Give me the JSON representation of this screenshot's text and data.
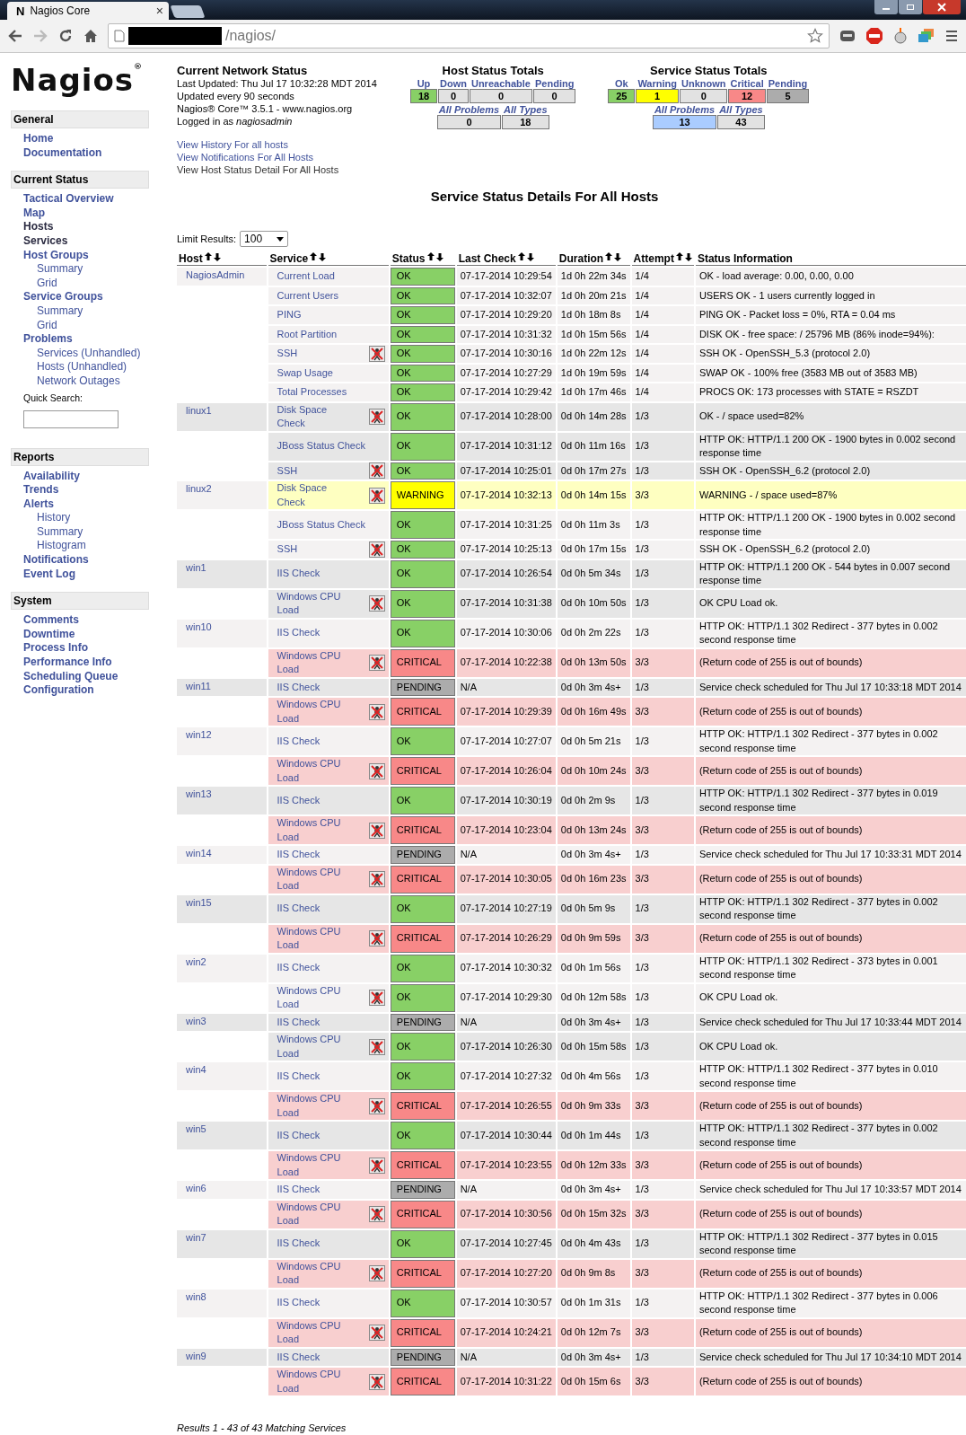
{
  "browser": {
    "favicon": "N",
    "tab_title": "Nagios Core",
    "tab_close": "×",
    "url": "/nagios/"
  },
  "logo": "Nagios$^{®}$",
  "sidebar": [
    {
      "title": "General",
      "items": [
        {
          "label": "Home",
          "visited": false
        },
        {
          "label": "Documentation",
          "visited": false
        }
      ]
    },
    {
      "title": "Current Status",
      "items": [
        {
          "label": "Tactical Overview",
          "visited": false
        },
        {
          "label": "Map",
          "visited": false
        },
        {
          "label": "Hosts",
          "visited": true
        },
        {
          "label": "Services",
          "visited": true
        },
        {
          "label": "Host Groups",
          "visited": false,
          "children": [
            {
              "label": "Summary",
              "visited": false
            },
            {
              "label": "Grid",
              "visited": false
            }
          ]
        },
        {
          "label": "Service Groups",
          "visited": false,
          "children": [
            {
              "label": "Summary",
              "visited": false
            },
            {
              "label": "Grid",
              "visited": false
            }
          ]
        },
        {
          "label": "Problems",
          "visited": false,
          "children": [
            {
              "label": "Services (Unhandled)",
              "visited": false
            },
            {
              "label": "Hosts (Unhandled)",
              "visited": false
            },
            {
              "label": "Network Outages",
              "visited": false
            }
          ]
        }
      ],
      "quick_search": {
        "label": "Quick Search:"
      }
    },
    {
      "title": "Reports",
      "items": [
        {
          "label": "Availability",
          "visited": false
        },
        {
          "label": "Trends",
          "visited": false
        },
        {
          "label": "Alerts",
          "visited": false,
          "children": [
            {
              "label": "History",
              "visited": false
            },
            {
              "label": "Summary",
              "visited": false
            },
            {
              "label": "Histogram",
              "visited": false
            }
          ]
        },
        {
          "label": "Notifications",
          "visited": false
        },
        {
          "label": "Event Log",
          "visited": false
        }
      ]
    },
    {
      "title": "System",
      "items": [
        {
          "label": "Comments",
          "visited": false
        },
        {
          "label": "Downtime",
          "visited": false
        },
        {
          "label": "Process Info",
          "visited": false
        },
        {
          "label": "Performance Info",
          "visited": false
        },
        {
          "label": "Scheduling Queue",
          "visited": false
        },
        {
          "label": "Configuration",
          "visited": false
        }
      ]
    }
  ],
  "network_status": {
    "title": "Current Network Status",
    "lines": [
      "Last Updated: Thu Jul 17 10:32:28 MDT 2014",
      "Updated every 90 seconds",
      "Nagios® Core™ 3.5.1 - www.nagios.org",
      "Logged in as *nagiosadmin*"
    ],
    "links": [
      "View History For all hosts",
      "View Notifications For All Hosts",
      "View Host Status Detail For All Hosts"
    ]
  },
  "host_totals": {
    "title": "Host Status Totals",
    "columns": [
      {
        "label": "Up",
        "value": "18",
        "kind": "ok"
      },
      {
        "label": "Down",
        "value": "0",
        "kind": "neutral"
      },
      {
        "label": "Unreachable",
        "value": "0",
        "kind": "neutral"
      },
      {
        "label": "Pending",
        "value": "0",
        "kind": "neutral"
      }
    ],
    "summary": [
      {
        "label": "All Problems",
        "value": "0",
        "kind": "neutral"
      },
      {
        "label": "All Types",
        "value": "18",
        "kind": "neutral"
      }
    ]
  },
  "service_totals": {
    "title": "Service Status Totals",
    "columns": [
      {
        "label": "Ok",
        "value": "25",
        "kind": "ok"
      },
      {
        "label": "Warning",
        "value": "1",
        "kind": "warning"
      },
      {
        "label": "Unknown",
        "value": "0",
        "kind": "neutral"
      },
      {
        "label": "Critical",
        "value": "12",
        "kind": "critical"
      },
      {
        "label": "Pending",
        "value": "5",
        "kind": "pending"
      }
    ],
    "summary": [
      {
        "label": "All Problems",
        "value": "13",
        "kind": "highlight"
      },
      {
        "label": "All Types",
        "value": "43",
        "kind": "neutral"
      }
    ]
  },
  "page_title": "Service Status Details For All Hosts",
  "limit": {
    "label": "Limit Results:",
    "value": "100"
  },
  "table": {
    "columns": [
      {
        "label": "Host",
        "sortable": true
      },
      {
        "label": "Service",
        "sortable": true
      },
      {
        "label": "Status",
        "sortable": true
      },
      {
        "label": "Last Check",
        "sortable": true
      },
      {
        "label": "Duration",
        "sortable": true
      },
      {
        "label": "Attempt",
        "sortable": true
      },
      {
        "label": "Status Information",
        "sortable": false
      }
    ],
    "hosts": [
      {
        "name": "NagiosAdmin",
        "services": [
          {
            "name": "Current Load",
            "icon": false,
            "kind": "ok",
            "status": "OK",
            "last_check": "07-17-2014 10:29:54",
            "duration": "1d 0h 22m 34s",
            "attempt": "1/4",
            "info": "OK - load average: 0.00, 0.00, 0.00"
          },
          {
            "name": "Current Users",
            "icon": false,
            "kind": "ok",
            "status": "OK",
            "last_check": "07-17-2014 10:32:07",
            "duration": "1d 0h 20m 21s",
            "attempt": "1/4",
            "info": "USERS OK - 1 users currently logged in"
          },
          {
            "name": "PING",
            "icon": false,
            "kind": "ok",
            "status": "OK",
            "last_check": "07-17-2014 10:29:20",
            "duration": "1d 0h 18m 8s",
            "attempt": "1/4",
            "info": "PING OK - Packet loss = 0%, RTA = 0.04 ms"
          },
          {
            "name": "Root Partition",
            "icon": false,
            "kind": "ok",
            "status": "OK",
            "last_check": "07-17-2014 10:31:32",
            "duration": "1d 0h 15m 56s",
            "attempt": "1/4",
            "info": "DISK OK - free space: / 25796 MB (86% inode=94%):"
          },
          {
            "name": "SSH",
            "icon": true,
            "kind": "ok",
            "status": "OK",
            "last_check": "07-17-2014 10:30:16",
            "duration": "1d 0h 22m 12s",
            "attempt": "1/4",
            "info": "SSH OK - OpenSSH_5.3 (protocol 2.0)"
          },
          {
            "name": "Swap Usage",
            "icon": false,
            "kind": "ok",
            "status": "OK",
            "last_check": "07-17-2014 10:27:29",
            "duration": "1d 0h 19m 59s",
            "attempt": "1/4",
            "info": "SWAP OK - 100% free (3583 MB out of 3583 MB)"
          },
          {
            "name": "Total Processes",
            "icon": false,
            "kind": "ok",
            "status": "OK",
            "last_check": "07-17-2014 10:29:42",
            "duration": "1d 0h 17m 46s",
            "attempt": "1/4",
            "info": "PROCS OK: 173 processes with STATE = RSZDT"
          }
        ]
      },
      {
        "name": "linux1",
        "services": [
          {
            "name": "Disk Space Check",
            "icon": true,
            "kind": "ok",
            "status": "OK",
            "last_check": "07-17-2014 10:28:00",
            "duration": "0d 0h 14m 28s",
            "attempt": "1/3",
            "info": "OK - / space used=82%"
          },
          {
            "name": "JBoss Status Check",
            "icon": false,
            "kind": "ok",
            "status": "OK",
            "last_check": "07-17-2014 10:31:12",
            "duration": "0d 0h 11m 16s",
            "attempt": "1/3",
            "info": "HTTP OK: HTTP/1.1 200 OK - 1900 bytes in 0.002 second response time"
          },
          {
            "name": "SSH",
            "icon": true,
            "kind": "ok",
            "status": "OK",
            "last_check": "07-17-2014 10:25:01",
            "duration": "0d 0h 17m 27s",
            "attempt": "1/3",
            "info": "SSH OK - OpenSSH_6.2 (protocol 2.0)"
          }
        ]
      },
      {
        "name": "linux2",
        "services": [
          {
            "name": "Disk Space Check",
            "icon": true,
            "kind": "warning",
            "status": "WARNING",
            "last_check": "07-17-2014 10:32:13",
            "duration": "0d 0h 14m 15s",
            "attempt": "3/3",
            "info": "WARNING - / space used=87%"
          },
          {
            "name": "JBoss Status Check",
            "icon": false,
            "kind": "ok",
            "status": "OK",
            "last_check": "07-17-2014 10:31:25",
            "duration": "0d 0h 11m 3s",
            "attempt": "1/3",
            "info": "HTTP OK: HTTP/1.1 200 OK - 1900 bytes in 0.002 second response time"
          },
          {
            "name": "SSH",
            "icon": true,
            "kind": "ok",
            "status": "OK",
            "last_check": "07-17-2014 10:25:13",
            "duration": "0d 0h 17m 15s",
            "attempt": "1/3",
            "info": "SSH OK - OpenSSH_6.2 (protocol 2.0)"
          }
        ]
      },
      {
        "name": "win1",
        "services": [
          {
            "name": "IIS Check",
            "icon": false,
            "kind": "ok",
            "status": "OK",
            "last_check": "07-17-2014 10:26:54",
            "duration": "0d 0h 5m 34s",
            "attempt": "1/3",
            "info": "HTTP OK: HTTP/1.1 200 OK - 544 bytes in 0.007 second response time"
          },
          {
            "name": "Windows CPU Load",
            "icon": true,
            "kind": "ok",
            "status": "OK",
            "last_check": "07-17-2014 10:31:38",
            "duration": "0d 0h 10m 50s",
            "attempt": "1/3",
            "info": "OK CPU Load ok."
          }
        ]
      },
      {
        "name": "win10",
        "services": [
          {
            "name": "IIS Check",
            "icon": false,
            "kind": "ok",
            "status": "OK",
            "last_check": "07-17-2014 10:30:06",
            "duration": "0d 0h 2m 22s",
            "attempt": "1/3",
            "info": "HTTP OK: HTTP/1.1 302 Redirect - 377 bytes in 0.002 second response time"
          },
          {
            "name": "Windows CPU Load",
            "icon": true,
            "kind": "critical",
            "status": "CRITICAL",
            "last_check": "07-17-2014 10:22:38",
            "duration": "0d 0h 13m 50s",
            "attempt": "3/3",
            "info": "(Return code of 255 is out of bounds)"
          }
        ]
      },
      {
        "name": "win11",
        "services": [
          {
            "name": "IIS Check",
            "icon": false,
            "kind": "pending",
            "status": "PENDING",
            "last_check": "N/A",
            "duration": "0d 0h 3m 4s+",
            "attempt": "1/3",
            "info": "Service check scheduled for Thu Jul 17 10:33:18 MDT 2014"
          },
          {
            "name": "Windows CPU Load",
            "icon": true,
            "kind": "critical",
            "status": "CRITICAL",
            "last_check": "07-17-2014 10:29:39",
            "duration": "0d 0h 16m 49s",
            "attempt": "3/3",
            "info": "(Return code of 255 is out of bounds)"
          }
        ]
      },
      {
        "name": "win12",
        "services": [
          {
            "name": "IIS Check",
            "icon": false,
            "kind": "ok",
            "status": "OK",
            "last_check": "07-17-2014 10:27:07",
            "duration": "0d 0h 5m 21s",
            "attempt": "1/3",
            "info": "HTTP OK: HTTP/1.1 302 Redirect - 377 bytes in 0.002 second response time"
          },
          {
            "name": "Windows CPU Load",
            "icon": true,
            "kind": "critical",
            "status": "CRITICAL",
            "last_check": "07-17-2014 10:26:04",
            "duration": "0d 0h 10m 24s",
            "attempt": "3/3",
            "info": "(Return code of 255 is out of bounds)"
          }
        ]
      },
      {
        "name": "win13",
        "services": [
          {
            "name": "IIS Check",
            "icon": false,
            "kind": "ok",
            "status": "OK",
            "last_check": "07-17-2014 10:30:19",
            "duration": "0d 0h 2m 9s",
            "attempt": "1/3",
            "info": "HTTP OK: HTTP/1.1 302 Redirect - 377 bytes in 0.019 second response time"
          },
          {
            "name": "Windows CPU Load",
            "icon": true,
            "kind": "critical",
            "status": "CRITICAL",
            "last_check": "07-17-2014 10:23:04",
            "duration": "0d 0h 13m 24s",
            "attempt": "3/3",
            "info": "(Return code of 255 is out of bounds)"
          }
        ]
      },
      {
        "name": "win14",
        "services": [
          {
            "name": "IIS Check",
            "icon": false,
            "kind": "pending",
            "status": "PENDING",
            "last_check": "N/A",
            "duration": "0d 0h 3m 4s+",
            "attempt": "1/3",
            "info": "Service check scheduled for Thu Jul 17 10:33:31 MDT 2014"
          },
          {
            "name": "Windows CPU Load",
            "icon": true,
            "kind": "critical",
            "status": "CRITICAL",
            "last_check": "07-17-2014 10:30:05",
            "duration": "0d 0h 16m 23s",
            "attempt": "3/3",
            "info": "(Return code of 255 is out of bounds)"
          }
        ]
      },
      {
        "name": "win15",
        "services": [
          {
            "name": "IIS Check",
            "icon": false,
            "kind": "ok",
            "status": "OK",
            "last_check": "07-17-2014 10:27:19",
            "duration": "0d 0h 5m 9s",
            "attempt": "1/3",
            "info": "HTTP OK: HTTP/1.1 302 Redirect - 377 bytes in 0.002 second response time"
          },
          {
            "name": "Windows CPU Load",
            "icon": true,
            "kind": "critical",
            "status": "CRITICAL",
            "last_check": "07-17-2014 10:26:29",
            "duration": "0d 0h 9m 59s",
            "attempt": "3/3",
            "info": "(Return code of 255 is out of bounds)"
          }
        ]
      },
      {
        "name": "win2",
        "services": [
          {
            "name": "IIS Check",
            "icon": false,
            "kind": "ok",
            "status": "OK",
            "last_check": "07-17-2014 10:30:32",
            "duration": "0d 0h 1m 56s",
            "attempt": "1/3",
            "info": "HTTP OK: HTTP/1.1 302 Redirect - 373 bytes in 0.001 second response time"
          },
          {
            "name": "Windows CPU Load",
            "icon": true,
            "kind": "ok",
            "status": "OK",
            "last_check": "07-17-2014 10:29:30",
            "duration": "0d 0h 12m 58s",
            "attempt": "1/3",
            "info": "OK CPU Load ok."
          }
        ]
      },
      {
        "name": "win3",
        "services": [
          {
            "name": "IIS Check",
            "icon": false,
            "kind": "pending",
            "status": "PENDING",
            "last_check": "N/A",
            "duration": "0d 0h 3m 4s+",
            "attempt": "1/3",
            "info": "Service check scheduled for Thu Jul 17 10:33:44 MDT 2014"
          },
          {
            "name": "Windows CPU Load",
            "icon": true,
            "kind": "ok",
            "status": "OK",
            "last_check": "07-17-2014 10:26:30",
            "duration": "0d 0h 15m 58s",
            "attempt": "1/3",
            "info": "OK CPU Load ok."
          }
        ]
      },
      {
        "name": "win4",
        "services": [
          {
            "name": "IIS Check",
            "icon": false,
            "kind": "ok",
            "status": "OK",
            "last_check": "07-17-2014 10:27:32",
            "duration": "0d 0h 4m 56s",
            "attempt": "1/3",
            "info": "HTTP OK: HTTP/1.1 302 Redirect - 377 bytes in 0.010 second response time"
          },
          {
            "name": "Windows CPU Load",
            "icon": true,
            "kind": "critical",
            "status": "CRITICAL",
            "last_check": "07-17-2014 10:26:55",
            "duration": "0d 0h 9m 33s",
            "attempt": "3/3",
            "info": "(Return code of 255 is out of bounds)"
          }
        ]
      },
      {
        "name": "win5",
        "services": [
          {
            "name": "IIS Check",
            "icon": false,
            "kind": "ok",
            "status": "OK",
            "last_check": "07-17-2014 10:30:44",
            "duration": "0d 0h 1m 44s",
            "attempt": "1/3",
            "info": "HTTP OK: HTTP/1.1 302 Redirect - 377 bytes in 0.002 second response time"
          },
          {
            "name": "Windows CPU Load",
            "icon": true,
            "kind": "critical",
            "status": "CRITICAL",
            "last_check": "07-17-2014 10:23:55",
            "duration": "0d 0h 12m 33s",
            "attempt": "3/3",
            "info": "(Return code of 255 is out of bounds)"
          }
        ]
      },
      {
        "name": "win6",
        "services": [
          {
            "name": "IIS Check",
            "icon": false,
            "kind": "pending",
            "status": "PENDING",
            "last_check": "N/A",
            "duration": "0d 0h 3m 4s+",
            "attempt": "1/3",
            "info": "Service check scheduled for Thu Jul 17 10:33:57 MDT 2014"
          },
          {
            "name": "Windows CPU Load",
            "icon": true,
            "kind": "critical",
            "status": "CRITICAL",
            "last_check": "07-17-2014 10:30:56",
            "duration": "0d 0h 15m 32s",
            "attempt": "3/3",
            "info": "(Return code of 255 is out of bounds)"
          }
        ]
      },
      {
        "name": "win7",
        "services": [
          {
            "name": "IIS Check",
            "icon": false,
            "kind": "ok",
            "status": "OK",
            "last_check": "07-17-2014 10:27:45",
            "duration": "0d 0h 4m 43s",
            "attempt": "1/3",
            "info": "HTTP OK: HTTP/1.1 302 Redirect - 377 bytes in 0.015 second response time"
          },
          {
            "name": "Windows CPU Load",
            "icon": true,
            "kind": "critical",
            "status": "CRITICAL",
            "last_check": "07-17-2014 10:27:20",
            "duration": "0d 0h 9m 8s",
            "attempt": "3/3",
            "info": "(Return code of 255 is out of bounds)"
          }
        ]
      },
      {
        "name": "win8",
        "services": [
          {
            "name": "IIS Check",
            "icon": false,
            "kind": "ok",
            "status": "OK",
            "last_check": "07-17-2014 10:30:57",
            "duration": "0d 0h 1m 31s",
            "attempt": "1/3",
            "info": "HTTP OK: HTTP/1.1 302 Redirect - 377 bytes in 0.006 second response time"
          },
          {
            "name": "Windows CPU Load",
            "icon": true,
            "kind": "critical",
            "status": "CRITICAL",
            "last_check": "07-17-2014 10:24:21",
            "duration": "0d 0h 12m 7s",
            "attempt": "3/3",
            "info": "(Return code of 255 is out of bounds)"
          }
        ]
      },
      {
        "name": "win9",
        "services": [
          {
            "name": "IIS Check",
            "icon": false,
            "kind": "pending",
            "status": "PENDING",
            "last_check": "N/A",
            "duration": "0d 0h 3m 4s+",
            "attempt": "1/3",
            "info": "Service check scheduled for Thu Jul 17 10:34:10 MDT 2014"
          },
          {
            "name": "Windows CPU Load",
            "icon": true,
            "kind": "critical",
            "status": "CRITICAL",
            "last_check": "07-17-2014 10:31:22",
            "duration": "0d 0h 15m 6s",
            "attempt": "3/3",
            "info": "(Return code of 255 is out of bounds)"
          }
        ]
      }
    ]
  },
  "footer": "Results 1 - 43 of 43 Matching Services"
}
